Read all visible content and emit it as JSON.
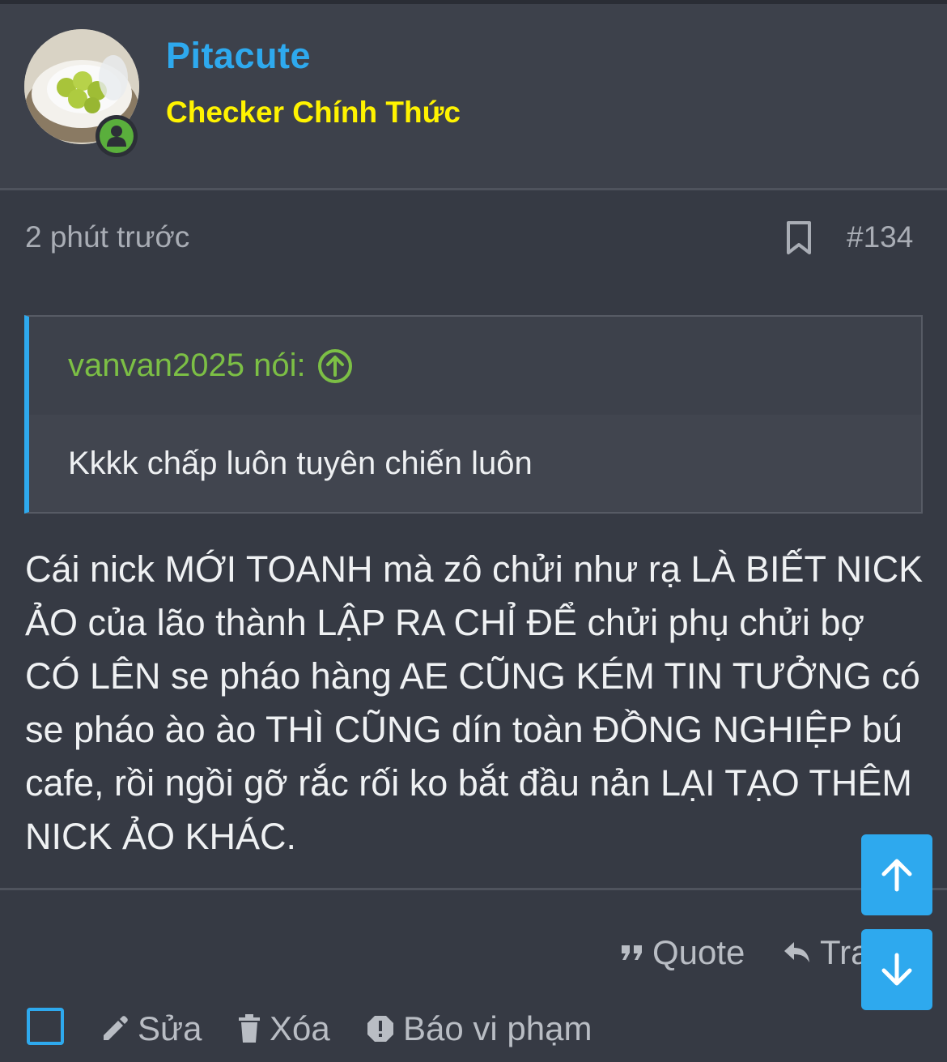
{
  "post": {
    "author": {
      "username": "Pitacute",
      "title": "Checker Chính Thức",
      "avatar_icon": "avatar-photo",
      "online_icon": "user-online-icon"
    },
    "time": "2 phút trước",
    "number": "#134",
    "quote": {
      "author_label": "vanvan2025 nói:",
      "text": "Kkkk chấp luôn tuyên chiến luôn"
    },
    "message": "Cái nick MỚI TOANH mà zô chửi như rạ LÀ BIẾT NICK ẢO của lão thành LẬP RA CHỈ ĐỂ chửi phụ chửi bợ CÓ LÊN se pháo hàng AE CŨNG KÉM TIN TƯỞNG có se pháo ào ào THÌ CŨNG dín toàn ĐỒNG NGHIỆP bú cafe, rồi ngồi gỡ rắc rối ko bắt đầu nản LẠI TẠO THÊM NICK ẢO KHÁC."
  },
  "actions": {
    "quote_label": "Quote",
    "reply_label": "Tra",
    "edit_label": "Sửa",
    "delete_label": "Xóa",
    "report_label": "Báo vi phạm"
  },
  "colors": {
    "accent": "#2ea9ee",
    "username": "#2ea9ee",
    "user_title": "#fff300",
    "quote_author": "#7cbf45",
    "online": "#5aaf3c"
  }
}
